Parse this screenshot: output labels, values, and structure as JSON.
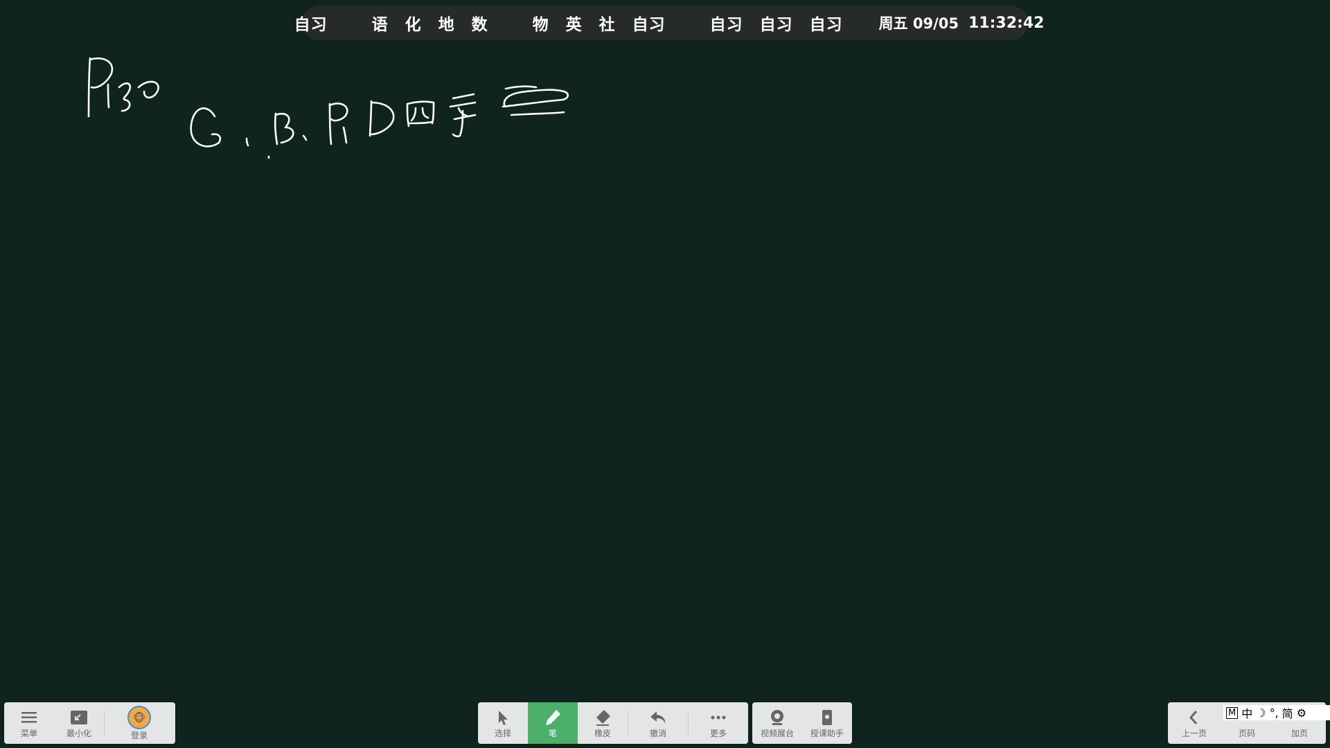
{
  "schedule": {
    "group1": [
      "自习"
    ],
    "group2": [
      "语",
      "化",
      "地",
      "数"
    ],
    "group3": [
      "物",
      "英",
      "社",
      "自习"
    ],
    "group4": [
      "自习",
      "自习",
      "自习"
    ],
    "date": "周五 09/05",
    "time": "11:32:42"
  },
  "left_toolbar": {
    "menu_label": "菜单",
    "minimize_label": "最小化",
    "login_label": "登录"
  },
  "center_toolbar": {
    "select_label": "选择",
    "pen_label": "笔",
    "eraser_label": "橡皮",
    "undo_label": "撤消",
    "more_label": "更多"
  },
  "center_toolbar2": {
    "video_label": "视频展台",
    "assistant_label": "授课助手"
  },
  "right_toolbar": {
    "prev_label": "上一页",
    "page_label": "页码",
    "add_label": "加页"
  },
  "ime": {
    "mode": "M",
    "lang": "中",
    "moon": "☽",
    "punct": "°,",
    "simplified": "简",
    "settings": "⚙"
  },
  "colors": {
    "board": "#10241f",
    "active_tool": "#4caf6a",
    "toolbar": "#e4e6e5"
  }
}
